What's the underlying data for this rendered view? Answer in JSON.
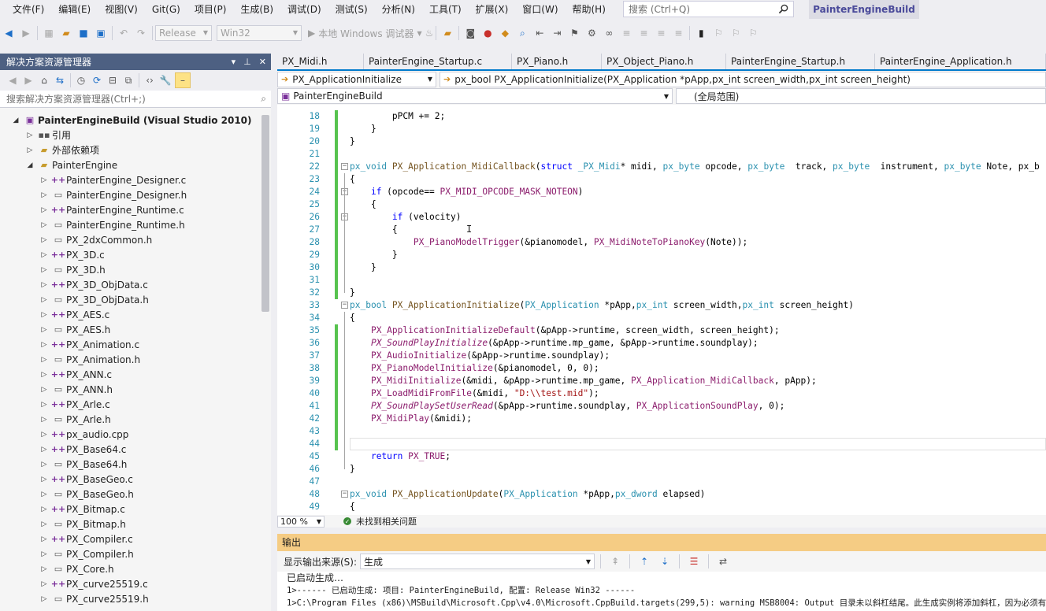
{
  "menu": [
    "文件(F)",
    "编辑(E)",
    "视图(V)",
    "Git(G)",
    "项目(P)",
    "生成(B)",
    "调试(D)",
    "测试(S)",
    "分析(N)",
    "工具(T)",
    "扩展(X)",
    "窗口(W)",
    "帮助(H)"
  ],
  "search": {
    "placeholder": "搜索 (Ctrl+Q)"
  },
  "solution_name": "PainterEngineBuild",
  "toolbar": {
    "config": "Release",
    "platform": "Win32",
    "run_label": "本地 Windows 调试器"
  },
  "solution_explorer": {
    "title": "解决方案资源管理器",
    "search_placeholder": "搜索解决方案资源管理器(Ctrl+;)",
    "root": "PainterEngineBuild (Visual Studio 2010)",
    "references": "引用",
    "external_deps": "外部依赖项",
    "project": "PainterEngine",
    "files": [
      {
        "name": "PainterEngine_Designer.c",
        "type": "c"
      },
      {
        "name": "PainterEngine_Designer.h",
        "type": "h"
      },
      {
        "name": "PainterEngine_Runtime.c",
        "type": "c"
      },
      {
        "name": "PainterEngine_Runtime.h",
        "type": "h"
      },
      {
        "name": "PX_2dxCommon.h",
        "type": "h"
      },
      {
        "name": "PX_3D.c",
        "type": "c"
      },
      {
        "name": "PX_3D.h",
        "type": "h"
      },
      {
        "name": "PX_3D_ObjData.c",
        "type": "c"
      },
      {
        "name": "PX_3D_ObjData.h",
        "type": "h"
      },
      {
        "name": "PX_AES.c",
        "type": "c"
      },
      {
        "name": "PX_AES.h",
        "type": "h"
      },
      {
        "name": "PX_Animation.c",
        "type": "c"
      },
      {
        "name": "PX_Animation.h",
        "type": "h"
      },
      {
        "name": "PX_ANN.c",
        "type": "c"
      },
      {
        "name": "PX_ANN.h",
        "type": "h"
      },
      {
        "name": "PX_Arle.c",
        "type": "c"
      },
      {
        "name": "PX_Arle.h",
        "type": "h"
      },
      {
        "name": "px_audio.cpp",
        "type": "c"
      },
      {
        "name": "PX_Base64.c",
        "type": "c"
      },
      {
        "name": "PX_Base64.h",
        "type": "h"
      },
      {
        "name": "PX_BaseGeo.c",
        "type": "c"
      },
      {
        "name": "PX_BaseGeo.h",
        "type": "h"
      },
      {
        "name": "PX_Bitmap.c",
        "type": "c"
      },
      {
        "name": "PX_Bitmap.h",
        "type": "h"
      },
      {
        "name": "PX_Compiler.c",
        "type": "c"
      },
      {
        "name": "PX_Compiler.h",
        "type": "h"
      },
      {
        "name": "PX_Core.h",
        "type": "h"
      },
      {
        "name": "PX_curve25519.c",
        "type": "c"
      },
      {
        "name": "PX_curve25519.h",
        "type": "h"
      }
    ]
  },
  "editor": {
    "tabs": [
      "PX_Midi.h",
      "PainterEngine_Startup.c",
      "PX_Piano.h",
      "PX_Object_Piano.h",
      "PainterEngine_Startup.h",
      "PainterEngine_Application.h"
    ],
    "nav_function": "PX_ApplicationInitialize",
    "nav_signature": "px_bool PX_ApplicationInitialize(PX_Application *pApp,px_int screen_width,px_int screen_height)",
    "nav_project": "PainterEngineBuild",
    "nav_scope": "(全局范围)",
    "lines": [
      {
        "n": "18",
        "segs": [
          [
            "",
            "        pPCM += 2;"
          ]
        ]
      },
      {
        "n": "19",
        "segs": [
          [
            "",
            "    }"
          ]
        ]
      },
      {
        "n": "20",
        "segs": [
          [
            "",
            "}"
          ]
        ]
      },
      {
        "n": "21",
        "segs": [
          [
            "",
            ""
          ]
        ]
      },
      {
        "n": "22",
        "segs": [
          [
            "ty",
            "px_void"
          ],
          [
            "",
            " "
          ],
          [
            "fn",
            "PX_Application_MidiCallback"
          ],
          [
            "",
            "("
          ],
          [
            "kw",
            "struct"
          ],
          [
            "",
            " "
          ],
          [
            "ty",
            "_PX_Midi"
          ],
          [
            "",
            "* midi, "
          ],
          [
            "ty",
            "px_byte"
          ],
          [
            "",
            " opcode, "
          ],
          [
            "ty",
            "px_byte"
          ],
          [
            "",
            "  track, "
          ],
          [
            "ty",
            "px_byte"
          ],
          [
            "",
            "  instrument, "
          ],
          [
            "ty",
            "px_byte"
          ],
          [
            "",
            " Note, px_b"
          ]
        ]
      },
      {
        "n": "23",
        "segs": [
          [
            "",
            "{"
          ]
        ]
      },
      {
        "n": "24",
        "segs": [
          [
            "",
            "    "
          ],
          [
            "kw",
            "if"
          ],
          [
            "",
            " (opcode== "
          ],
          [
            "mac",
            "PX_MIDI_OPCODE_MASK_NOTEON"
          ],
          [
            "",
            ")"
          ]
        ]
      },
      {
        "n": "25",
        "segs": [
          [
            "",
            "    {"
          ]
        ]
      },
      {
        "n": "26",
        "segs": [
          [
            "",
            "        "
          ],
          [
            "kw",
            "if"
          ],
          [
            "",
            " (velocity)"
          ]
        ]
      },
      {
        "n": "27",
        "segs": [
          [
            "",
            "        {"
          ]
        ]
      },
      {
        "n": "28",
        "segs": [
          [
            "",
            "            "
          ],
          [
            "mac",
            "PX_PianoModelTrigger"
          ],
          [
            "",
            "(&pianomodel, "
          ],
          [
            "mac",
            "PX_MidiNoteToPianoKey"
          ],
          [
            "",
            "(Note));"
          ]
        ]
      },
      {
        "n": "29",
        "segs": [
          [
            "",
            "        }"
          ]
        ]
      },
      {
        "n": "30",
        "segs": [
          [
            "",
            "    }"
          ]
        ]
      },
      {
        "n": "31",
        "segs": [
          [
            "",
            ""
          ]
        ]
      },
      {
        "n": "32",
        "segs": [
          [
            "",
            "}"
          ]
        ]
      },
      {
        "n": "33",
        "segs": [
          [
            "ty",
            "px_bool"
          ],
          [
            "",
            " "
          ],
          [
            "fn",
            "PX_ApplicationInitialize"
          ],
          [
            "",
            "("
          ],
          [
            "ty",
            "PX_Application"
          ],
          [
            "",
            " *pApp,"
          ],
          [
            "ty",
            "px_int"
          ],
          [
            "",
            " screen_width,"
          ],
          [
            "ty",
            "px_int"
          ],
          [
            "",
            " screen_height)"
          ]
        ]
      },
      {
        "n": "34",
        "segs": [
          [
            "",
            "{"
          ]
        ]
      },
      {
        "n": "35",
        "segs": [
          [
            "",
            "    "
          ],
          [
            "mac",
            "PX_ApplicationInitializeDefault"
          ],
          [
            "",
            "(&pApp->runtime, screen_width, screen_height);"
          ]
        ]
      },
      {
        "n": "36",
        "segs": [
          [
            "",
            "    "
          ],
          [
            "mac it",
            "PX_SoundPlayInitialize"
          ],
          [
            "",
            "(&pApp->runtime.mp_game, &pApp->runtime.soundplay);"
          ]
        ]
      },
      {
        "n": "37",
        "segs": [
          [
            "",
            "    "
          ],
          [
            "mac",
            "PX_AudioInitialize"
          ],
          [
            "",
            "(&pApp->runtime.soundplay);"
          ]
        ]
      },
      {
        "n": "38",
        "segs": [
          [
            "",
            "    "
          ],
          [
            "mac",
            "PX_PianoModelInitialize"
          ],
          [
            "",
            "(&pianomodel, 0, 0);"
          ]
        ]
      },
      {
        "n": "39",
        "segs": [
          [
            "",
            "    "
          ],
          [
            "mac",
            "PX_MidiInitialize"
          ],
          [
            "",
            "(&midi, &pApp->runtime.mp_game, "
          ],
          [
            "mac",
            "PX_Application_MidiCallback"
          ],
          [
            "",
            ", pApp);"
          ]
        ]
      },
      {
        "n": "40",
        "segs": [
          [
            "",
            "    "
          ],
          [
            "mac",
            "PX_LoadMidiFromFile"
          ],
          [
            "",
            "(&midi, "
          ],
          [
            "str",
            "\"D:\\\\test.mid\""
          ],
          [
            "",
            ");"
          ]
        ]
      },
      {
        "n": "41",
        "segs": [
          [
            "",
            "    "
          ],
          [
            "mac it",
            "PX_SoundPlaySetUserRead"
          ],
          [
            "",
            "(&pApp->runtime.soundplay, "
          ],
          [
            "mac",
            "PX_ApplicationSoundPlay"
          ],
          [
            "",
            ", 0);"
          ]
        ]
      },
      {
        "n": "42",
        "segs": [
          [
            "",
            "    "
          ],
          [
            "mac",
            "PX_MidiPlay"
          ],
          [
            "",
            "(&midi);"
          ]
        ]
      },
      {
        "n": "43",
        "segs": [
          [
            "",
            ""
          ]
        ]
      },
      {
        "n": "44",
        "segs": [
          [
            "",
            ""
          ]
        ]
      },
      {
        "n": "45",
        "segs": [
          [
            "",
            "    "
          ],
          [
            "kw",
            "return"
          ],
          [
            "",
            " "
          ],
          [
            "mac",
            "PX_TRUE"
          ],
          [
            "",
            ";"
          ]
        ]
      },
      {
        "n": "46",
        "segs": [
          [
            "",
            "}"
          ]
        ]
      },
      {
        "n": "47",
        "segs": [
          [
            "",
            ""
          ]
        ]
      },
      {
        "n": "48",
        "segs": [
          [
            "ty",
            "px_void"
          ],
          [
            "",
            " "
          ],
          [
            "fn",
            "PX_ApplicationUpdate"
          ],
          [
            "",
            "("
          ],
          [
            "ty",
            "PX_Application"
          ],
          [
            "",
            " *pApp,"
          ],
          [
            "ty",
            "px_dword"
          ],
          [
            "",
            " elapsed)"
          ]
        ]
      },
      {
        "n": "49",
        "segs": [
          [
            "",
            "{"
          ]
        ]
      }
    ],
    "zoom": "100 %",
    "issues": "未找到相关问题"
  },
  "output": {
    "title": "输出",
    "source_label": "显示输出来源(S):",
    "source_value": "生成",
    "lines": [
      "已启动生成…",
      "1>------ 已启动生成: 项目: PainterEngineBuild, 配置: Release Win32 ------",
      "1>C:\\Program Files (x86)\\MSBuild\\Microsoft.Cpp\\v4.0\\Microsoft.CppBuild.targets(299,5): warning MSB8004: Output 目录未以斜杠结尾。此生成实例将添加斜杠，因为必须有"
    ]
  },
  "colors": {
    "accent": "#007acc",
    "title_bar": "#4d6082",
    "output_header": "#f5cc84",
    "change_bar": "#57c34f"
  }
}
